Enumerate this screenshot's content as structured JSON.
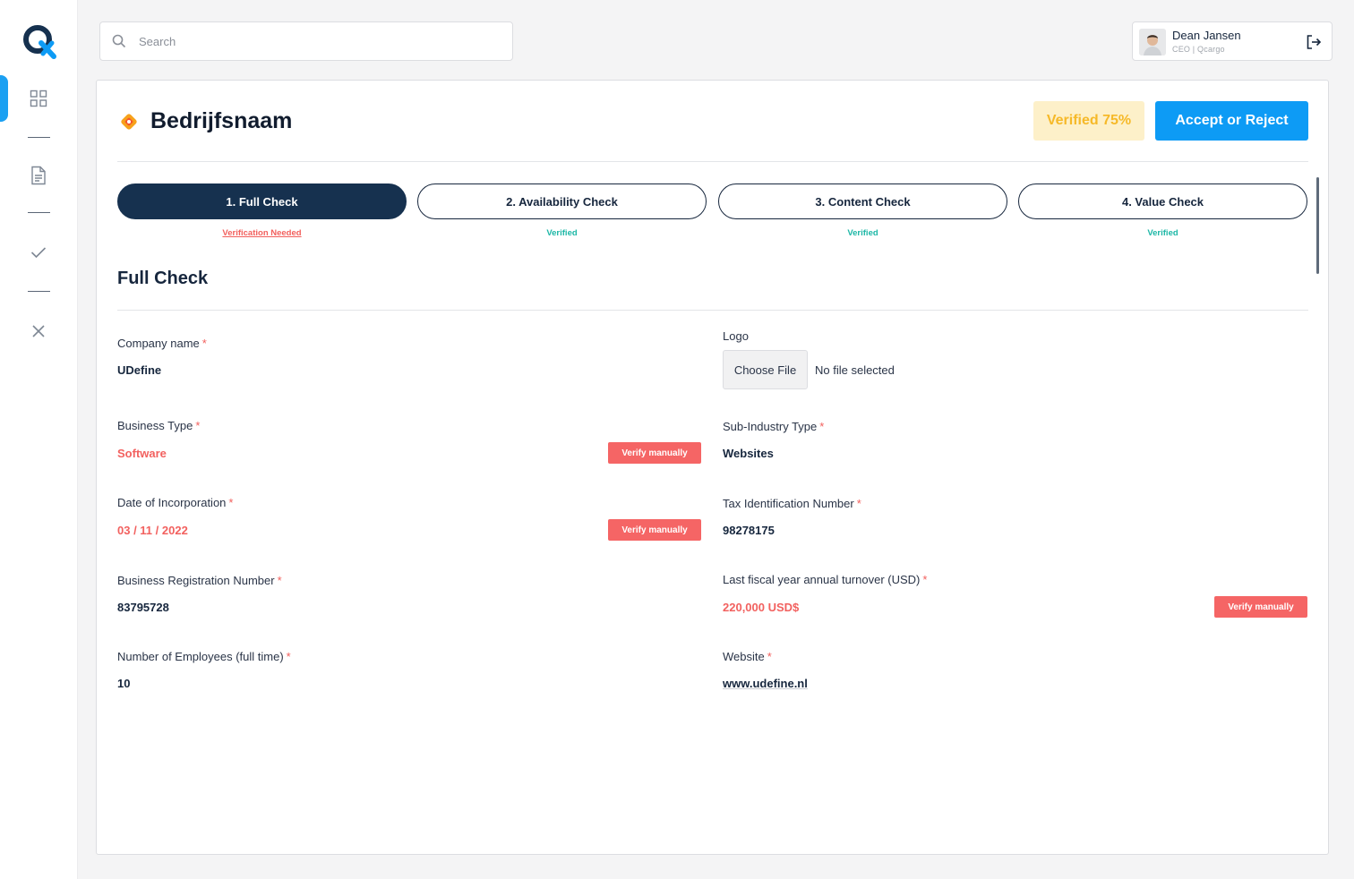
{
  "search": {
    "placeholder": "Search"
  },
  "user": {
    "name": "Dean Jansen",
    "role": "CEO | Qcargo"
  },
  "header": {
    "company_title": "Bedrijfsnaam",
    "verified_label": "Verified 75%",
    "accept_label": "Accept or Reject"
  },
  "steps": [
    {
      "label": "1. Full Check",
      "status": "Verification Needed"
    },
    {
      "label": "2. Availability Check",
      "status": "Verified"
    },
    {
      "label": "3. Content Check",
      "status": "Verified"
    },
    {
      "label": "4. Value Check",
      "status": "Verified"
    }
  ],
  "section": {
    "title": "Full Check"
  },
  "fields": {
    "company_name": {
      "label": "Company name",
      "value": "UDefine"
    },
    "logo": {
      "label": "Logo",
      "button": "Choose File",
      "status": "No file selected"
    },
    "business_type": {
      "label": "Business Type",
      "value": "Software"
    },
    "sub_industry": {
      "label": "Sub-Industry Type",
      "value": "Websites"
    },
    "incorporation_date": {
      "label": "Date of Incorporation",
      "value": "03 / 11 / 2022"
    },
    "tax_id": {
      "label": "Tax Identification Number",
      "value": "98278175"
    },
    "registration_number": {
      "label": "Business Registration Number",
      "value": "83795728"
    },
    "turnover": {
      "label": "Last fiscal year annual turnover (USD)",
      "value": "220,000 USD$"
    },
    "employees": {
      "label": "Number of Employees (full time)",
      "value": "10"
    },
    "website": {
      "label": "Website",
      "value": "www.udefine.nl"
    }
  },
  "required_marker": "*",
  "verify_label": "Verify manually",
  "colors": {
    "accent": "#0d9bf5",
    "navy": "#16314f",
    "warning": "#f25f5c",
    "success": "#1cb7a6",
    "badge_bg": "#fdf0c9",
    "badge_text": "#f6b928"
  },
  "icons": {
    "sidebar": [
      "dashboard-icon",
      "document-icon",
      "check-icon",
      "close-icon"
    ],
    "search": "search-icon",
    "logout": "logout-icon",
    "company": "company-diamond-icon"
  }
}
